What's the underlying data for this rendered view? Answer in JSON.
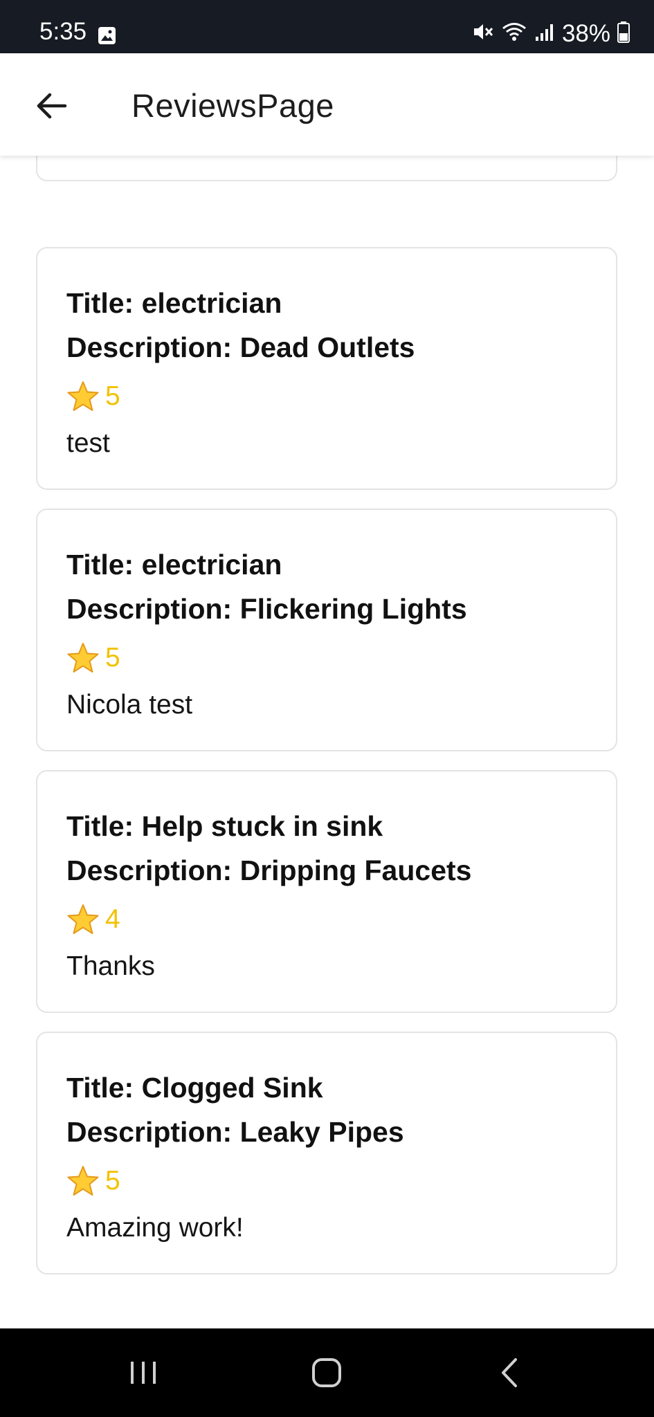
{
  "status_bar": {
    "time": "5:35",
    "battery": "38%",
    "icons": [
      "image-icon",
      "mute-icon",
      "wifi-icon",
      "signal-icon",
      "battery-icon"
    ]
  },
  "app_bar": {
    "title": "ReviewsPage",
    "back_icon": "arrow-left-icon"
  },
  "reviews": [
    {
      "title": "Title: electrician",
      "description": "Description: Dead Outlets",
      "rating": "5",
      "comment": "test"
    },
    {
      "title": "Title: electrician",
      "description": "Description: Flickering Lights",
      "rating": "5",
      "comment": "Nicola test"
    },
    {
      "title": "Title: Help stuck in sink",
      "description": "Description: Dripping Faucets",
      "rating": "4",
      "comment": "Thanks"
    },
    {
      "title": "Title: Clogged Sink",
      "description": "Description: Leaky Pipes",
      "rating": "5",
      "comment": "Amazing work!"
    }
  ],
  "colors": {
    "status_bar_bg": "#171b24",
    "rating_text": "#f2c200",
    "card_border": "#e4e4e4",
    "nav_bar_bg": "#000000"
  },
  "nav_bar": {
    "icons": [
      "recent-apps-icon",
      "home-icon",
      "back-icon"
    ]
  }
}
